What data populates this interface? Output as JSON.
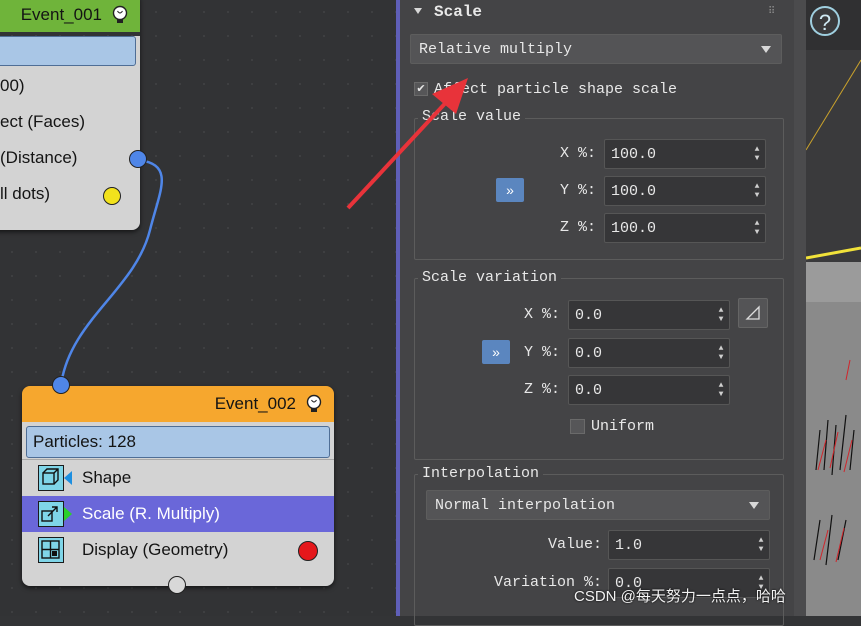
{
  "nodes": {
    "event1": {
      "title": "Event_001",
      "rows": [
        "00)",
        "ect (Faces)",
        "(Distance)",
        "ll dots)"
      ]
    },
    "event2": {
      "title": "Event_002",
      "particles": "Particles: 128",
      "rows": [
        "Shape",
        "Scale (R. Multiply)",
        "Display (Geometry)"
      ]
    }
  },
  "colors": {
    "event1_header": "#6fb43a",
    "event2_header": "#f6a72e",
    "selected_row": "#6a67d9",
    "wire": "#4f86e8",
    "annotation_arrow": "#e8333a"
  },
  "panel": {
    "scale_title": "Scale",
    "mode_dropdown": "Relative multiply",
    "affect_checkbox": "Affect particle shape scale",
    "scale_value": {
      "title": "Scale value",
      "x_label": "X %:",
      "x_value": "100.0",
      "y_label": "Y %:",
      "y_value": "100.0",
      "z_label": "Z %:",
      "z_value": "100.0",
      "lock": "»"
    },
    "scale_variation": {
      "title": "Scale variation",
      "x_label": "X %:",
      "x_value": "0.0",
      "y_label": "Y %:",
      "y_value": "0.0",
      "z_label": "Z %:",
      "z_value": "0.0",
      "lock": "»",
      "uniform": "Uniform"
    },
    "interpolation": {
      "title": "Interpolation",
      "mode_dropdown": "Normal interpolation",
      "value_label": "Value:",
      "value": "1.0",
      "variation_label": "Variation %:",
      "variation": "0.0"
    }
  },
  "help_button": "?",
  "watermark": "CSDN @每天努力一点点，哈哈"
}
